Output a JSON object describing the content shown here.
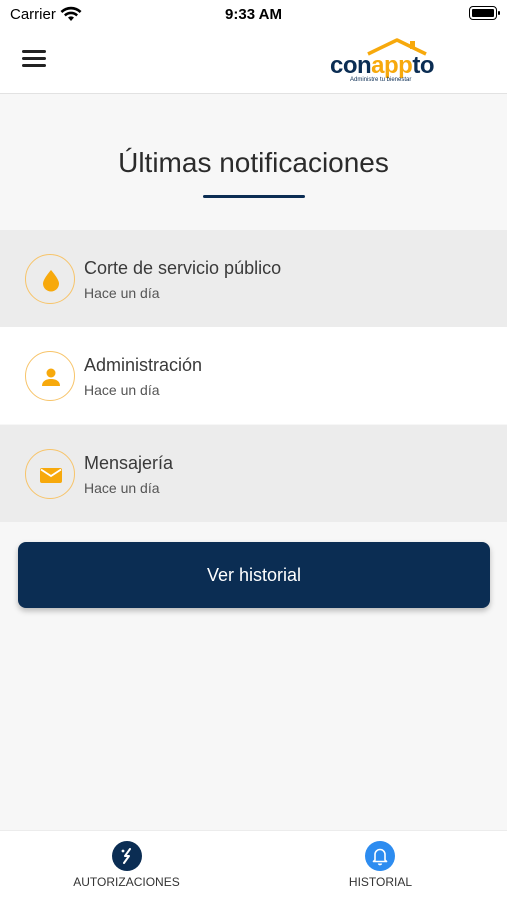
{
  "status_bar": {
    "carrier": "Carrier",
    "time": "9:33 AM"
  },
  "header": {
    "logo": {
      "part1": "con",
      "part2": "app",
      "part3": "to",
      "tagline": "Administre tu bienestar"
    }
  },
  "main": {
    "title": "Últimas notificaciones",
    "notifications": [
      {
        "title": "Corte de servicio público",
        "time": "Hace un día",
        "icon": "water-drop-icon"
      },
      {
        "title": "Administración",
        "time": "Hace un día",
        "icon": "person-icon"
      },
      {
        "title": "Mensajería",
        "time": "Hace un día",
        "icon": "envelope-icon"
      }
    ],
    "history_button": "Ver historial"
  },
  "tab_bar": {
    "tabs": [
      {
        "label": "AUTORIZACIONES",
        "icon": "authorization-icon",
        "active": false
      },
      {
        "label": "HISTORIAL",
        "icon": "bell-icon",
        "active": true
      }
    ]
  },
  "colors": {
    "primary": "#0b2d53",
    "accent": "#f7a90c",
    "active_tab": "#2d8cf0"
  }
}
